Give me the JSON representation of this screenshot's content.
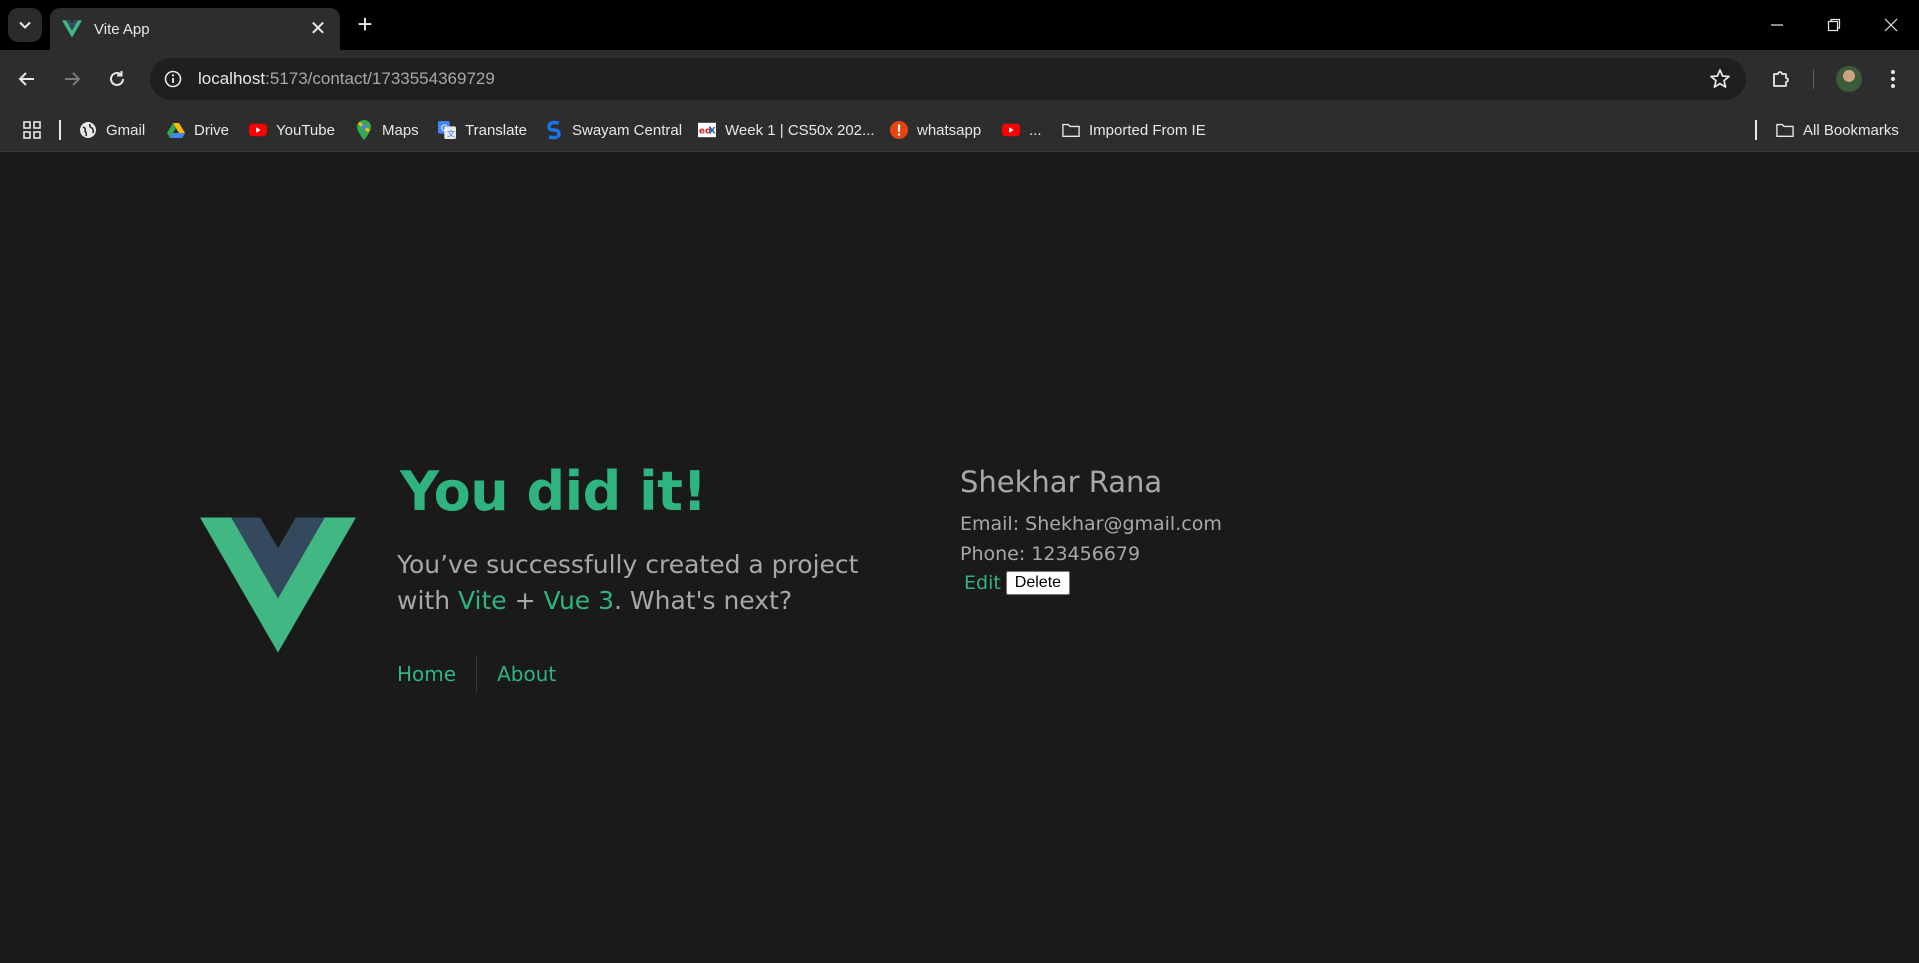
{
  "browser": {
    "tab_title": "Vite App",
    "url_host": "localhost",
    "url_path": ":5173/contact/1733554369729",
    "bookmarks": [
      {
        "label": "Gmail",
        "icon": "globe-icon"
      },
      {
        "label": "Drive",
        "icon": "drive-icon"
      },
      {
        "label": "YouTube",
        "icon": "youtube-icon"
      },
      {
        "label": "Maps",
        "icon": "maps-icon"
      },
      {
        "label": "Translate",
        "icon": "translate-icon"
      },
      {
        "label": "Swayam Central",
        "icon": "swayam-icon"
      },
      {
        "label": "Week 1 | CS50x 202...",
        "icon": "edx-icon"
      },
      {
        "label": "whatsapp",
        "icon": "alert-icon"
      },
      {
        "label": "...",
        "icon": "youtube-icon"
      },
      {
        "label": "Imported From IE",
        "icon": "folder-icon"
      }
    ],
    "all_bookmarks": "All Bookmarks"
  },
  "hero": {
    "title": "You did it!",
    "sub_prefix": "You’ve successfully created a project with",
    "vite": "Vite",
    "plus": "+",
    "vue": "Vue 3",
    "sub_suffix": ". What's next?"
  },
  "nav": {
    "home": "Home",
    "about": "About"
  },
  "contact": {
    "name": "Shekhar Rana",
    "email": "Email: Shekhar@gmail.com",
    "phone": "Phone: 123456679",
    "edit": "Edit",
    "delete": "Delete"
  },
  "colors": {
    "accent": "#2fb47f",
    "background": "#1a1a1a",
    "text": "#a8a8a8"
  }
}
